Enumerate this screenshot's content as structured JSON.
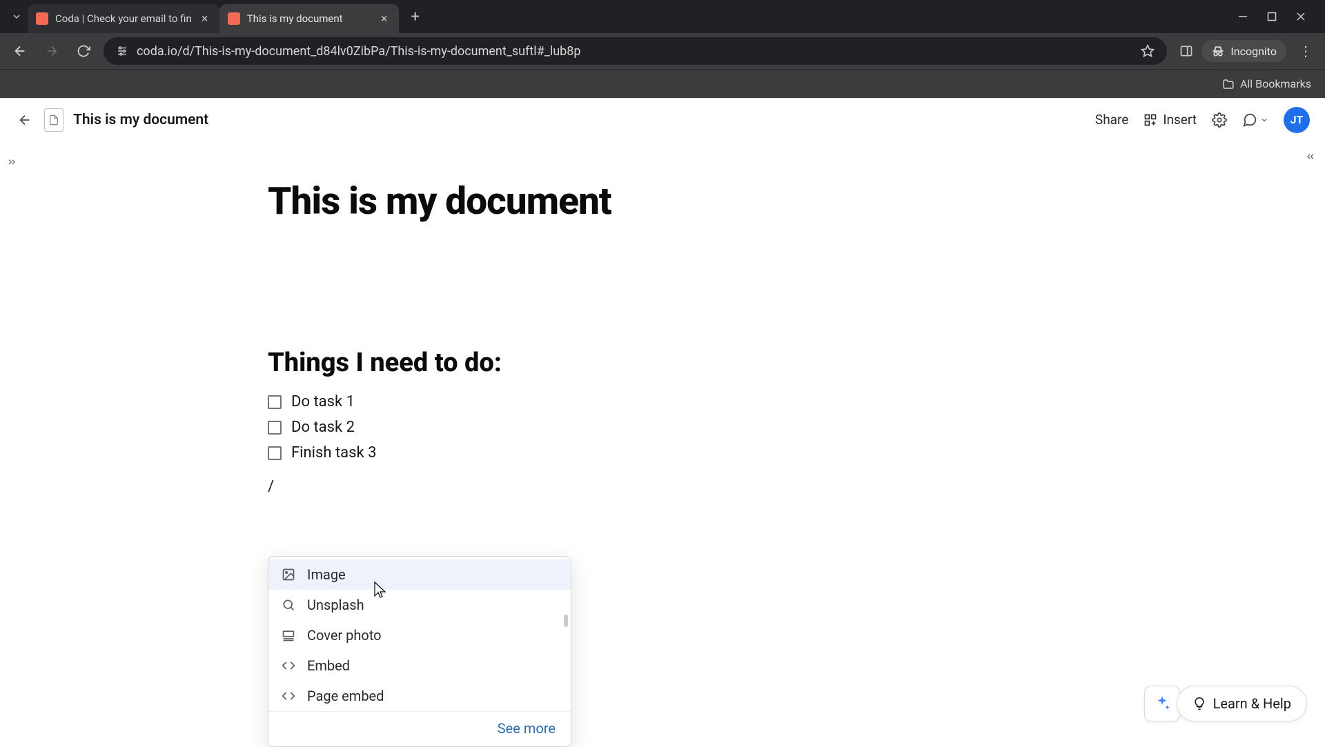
{
  "browser": {
    "tabs": [
      {
        "title": "Coda | Check your email to fin"
      },
      {
        "title": "This is my document"
      }
    ],
    "url": "coda.io/d/This-is-my-document_d84lv0ZibPa/This-is-my-document_suftl#_lub8p",
    "incognito_label": "Incognito",
    "all_bookmarks": "All Bookmarks"
  },
  "app": {
    "doc_name": "This is my document",
    "share": "Share",
    "insert": "Insert",
    "avatar_initials": "JT",
    "learn_help": "Learn & Help"
  },
  "page": {
    "title": "This is my document",
    "section": "Things I need to do:",
    "tasks": [
      "Do task 1",
      "Do task 2",
      "Finish task 3"
    ],
    "slash_char": "/"
  },
  "menu": {
    "items": [
      {
        "icon": "image",
        "label": "Image"
      },
      {
        "icon": "search",
        "label": "Unsplash"
      },
      {
        "icon": "cover",
        "label": "Cover photo"
      },
      {
        "icon": "code",
        "label": "Embed"
      },
      {
        "icon": "code",
        "label": "Page embed"
      }
    ],
    "see_more": "See more"
  }
}
